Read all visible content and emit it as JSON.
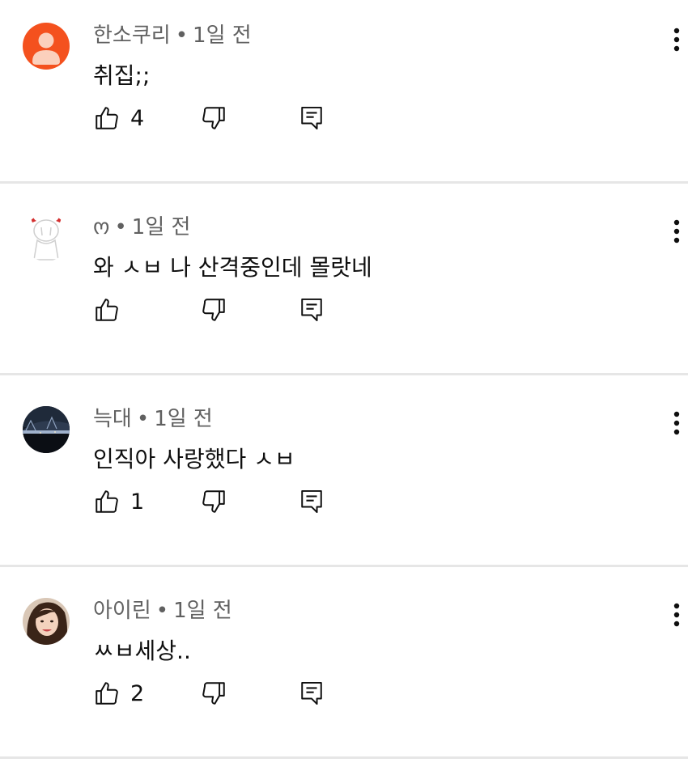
{
  "comments": [
    {
      "author": "한소쿠리",
      "time": "1일 전",
      "text": "취집;;",
      "likes": "4",
      "avatar": "default-orange-avatar",
      "avatar_color": "#f4511e"
    },
    {
      "author": "ო",
      "time": "1일 전",
      "text": "와 ㅅㅂ 나 산격중인데 몰랏네",
      "likes": "",
      "avatar": "devil-doodle-avatar"
    },
    {
      "author": "늑대",
      "time": "1일 전",
      "text": "인직아 사랑했다 ㅅㅂ",
      "likes": "1",
      "avatar": "night-bridge-avatar"
    },
    {
      "author": "아이린",
      "time": "1일 전",
      "text": "ㅆㅂ세상..",
      "likes": "2",
      "avatar": "portrait-avatar"
    }
  ],
  "separator": "•",
  "colors": {
    "meta_text": "#606060",
    "body_text": "#0f0f0f",
    "divider": "#e6e6e6"
  }
}
